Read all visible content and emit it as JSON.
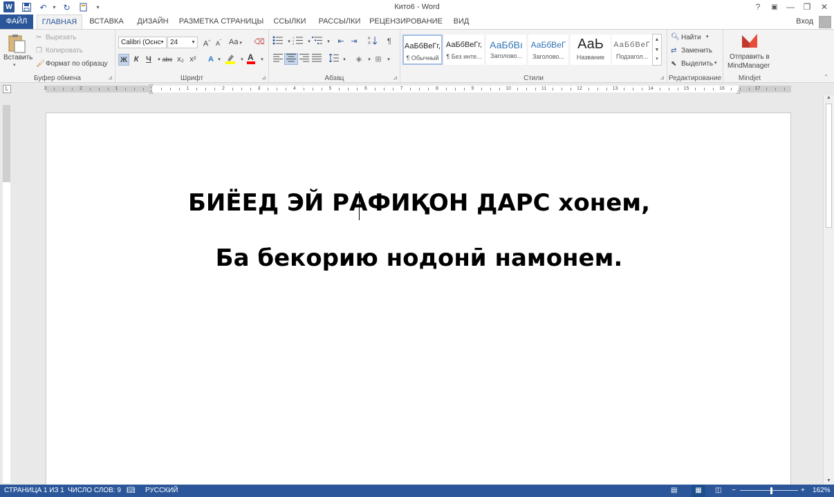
{
  "app": {
    "title": "Кито6 - Word",
    "logo_letter": "W",
    "quick_access": [
      "save-icon",
      "undo-icon",
      "redo-icon",
      "touch-mode-icon",
      "customize-icon"
    ],
    "window_buttons": {
      "help": "?",
      "ribbon_options": "▣",
      "minimize": "—",
      "restore": "❐",
      "close": "✕"
    },
    "sign_in": "Вход"
  },
  "tabs": [
    {
      "label": "ФАЙЛ"
    },
    {
      "label": "ГЛАВНАЯ",
      "active": true
    },
    {
      "label": "ВСТАВКА"
    },
    {
      "label": "ДИЗАЙН"
    },
    {
      "label": "РАЗМЕТКА СТРАНИЦЫ"
    },
    {
      "label": "ССЫЛКИ"
    },
    {
      "label": "РАССЫЛКИ"
    },
    {
      "label": "РЕЦЕНЗИРОВАНИЕ"
    },
    {
      "label": "ВИД"
    }
  ],
  "ribbon": {
    "clipboard": {
      "label": "Буфер обмена",
      "paste": "Вставить",
      "cut": "Вырезать",
      "copy": "Копировать",
      "format_painter": "Формат по образцу"
    },
    "font": {
      "label": "Шрифт",
      "font_name": "Calibri (Оснс",
      "font_size": "24",
      "bold": "Ж",
      "italic": "К",
      "underline": "Ч",
      "strike": "abc",
      "subscript": "x₂",
      "superscript": "x²",
      "case": "Aa",
      "grow": "A",
      "shrink": "A",
      "text_effects": "A",
      "font_color": "A",
      "highlight_color": "#ffff00",
      "font_color_value": "#ff0000"
    },
    "paragraph": {
      "label": "Абзац",
      "pilcrow": "¶"
    },
    "styles": {
      "label": "Стили",
      "items": [
        {
          "sample": "АаБбВеГг,",
          "name": "¶ Обычный",
          "selected": true
        },
        {
          "sample": "АаБбВеГг,",
          "name": "¶ Без инте..."
        },
        {
          "sample": "АаБбВı",
          "name": "Заголово..."
        },
        {
          "sample": "АаБбВеГ",
          "name": "Заголово..."
        },
        {
          "sample": "АаЬ",
          "name": "Название"
        },
        {
          "sample": "АаБбВеГ",
          "name": "Подзагол..."
        }
      ]
    },
    "editing": {
      "label": "Редактирование",
      "find": "Найти",
      "replace": "Заменить",
      "select": "Выделить"
    },
    "mindjet": {
      "label": "Mindjet",
      "send_line1": "Отправить в",
      "send_line2": "MindManager"
    }
  },
  "ruler": {
    "corner": "L",
    "numbers": [
      "3",
      "2",
      "1",
      "1",
      "2",
      "3",
      "4",
      "5",
      "6",
      "7",
      "8",
      "9",
      "10",
      "11",
      "12",
      "13",
      "14",
      "15",
      "16",
      "17"
    ]
  },
  "document": {
    "line1": "БИЁЕД ЭЙ РАФИҚОН ДАРС хонем,",
    "line2": "Ба бекорию нодонӣ намонем."
  },
  "status": {
    "page": "СТРАНИЦА 1 ИЗ 1",
    "words": "ЧИСЛО СЛОВ: 9",
    "language": "РУССКИЙ",
    "zoom": "162%",
    "zoom_minus": "−",
    "zoom_plus": "+"
  },
  "colors": {
    "accent": "#2b579a",
    "ribbon_bg": "#f3f3f3",
    "workspace": "#e9e9e9"
  }
}
